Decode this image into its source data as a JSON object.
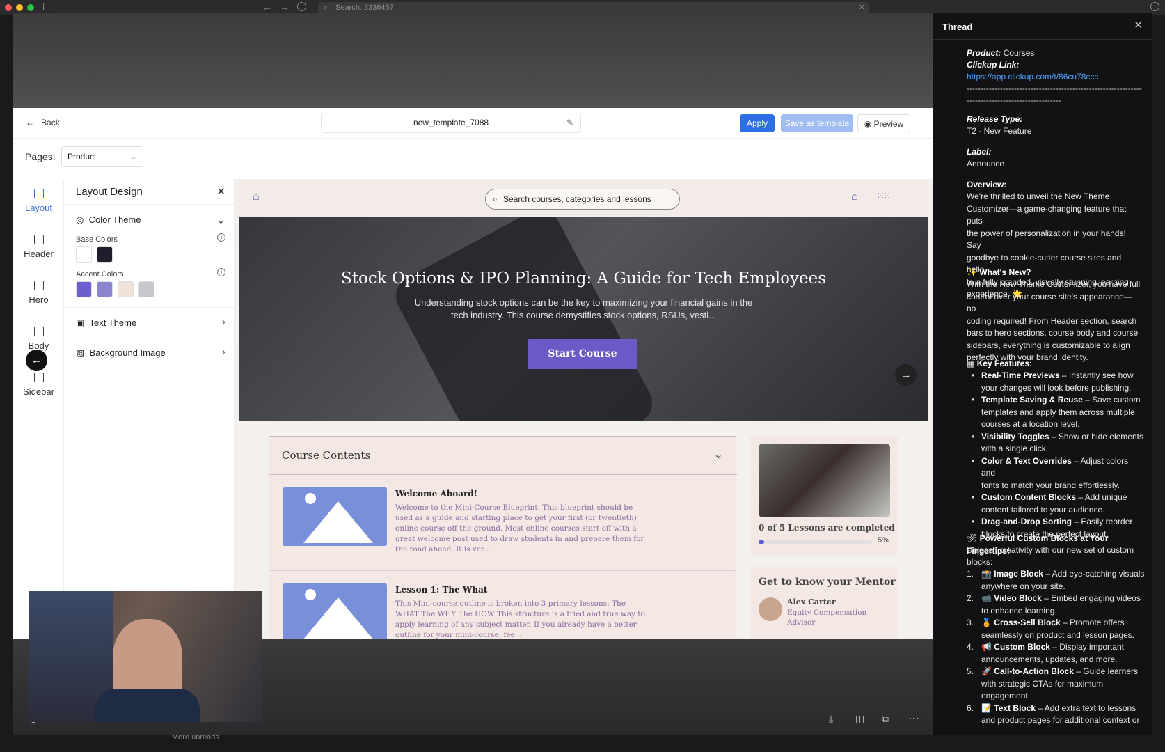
{
  "browser": {
    "search_placeholder": "Search: 3336457"
  },
  "editor": {
    "back_label": "Back",
    "template_name": "new_template_7088",
    "apply_label": "Apply",
    "save_template_label": "Save as template",
    "preview_label": "Preview",
    "pages_label": "Pages:",
    "pages_value": "Product"
  },
  "rail": [
    {
      "label": "Layout"
    },
    {
      "label": "Header"
    },
    {
      "label": "Hero"
    },
    {
      "label": "Body"
    },
    {
      "label": "Sidebar"
    }
  ],
  "panel": {
    "title": "Layout Design",
    "color_theme": "Color Theme",
    "base_colors_label": "Base Colors",
    "accent_colors_label": "Accent Colors",
    "text_theme": "Text Theme",
    "background_image": "Background Image",
    "base_colors": [
      "#ffffff",
      "#1e1d2b"
    ],
    "accent_colors": [
      "#6a5fcc",
      "#8a85cc",
      "#efe4dc",
      "#c8c6cc"
    ]
  },
  "preview": {
    "search_placeholder": "Search courses, categories and lessons",
    "hero_title": "Stock Options & IPO Planning: A Guide for Tech Employees",
    "hero_desc_1": "Understanding stock options can be the key to maximizing your financial gains in the",
    "hero_desc_2": "tech industry. This course demystifies stock options, RSUs, vesti...",
    "start_course": "Start Course",
    "course_contents": "Course Contents",
    "lessons": [
      {
        "title": "Welcome Aboard!",
        "lines": [
          "Welcome to the Mini-Course Blueprint. This blueprint should be",
          "used as a guide and starting place to get your first (or twentieth)",
          "online course off the ground. Most online courses start off with a",
          "great welcome post used to draw students in and prepare them for",
          "the road ahead. It is ver..."
        ]
      },
      {
        "title": "Lesson 1: The What",
        "lines": [
          "This Mini-course outline is broken into 3 primary lessons: The",
          "WHAT The WHY The HOW This structure is a tried and true way to",
          "apply learning of any subject matter. If you already have a better",
          "outline for your mini-course, fee..."
        ]
      }
    ],
    "progress_text": "0 of 5 Lessons are completed",
    "progress_pct": "5%",
    "progress_value": 0.05,
    "mentor_heading": "Get to know your Mentor",
    "mentor_name": "Alex Carter",
    "mentor_role_1": "Equity Compensation",
    "mentor_role_2": "Advisor"
  },
  "thread": {
    "title": "Thread",
    "product_label": "Product:",
    "product_value": "Courses",
    "clickup_label": "Clickup Link:",
    "clickup_url": "https://app.clickup.com/t/86cu78ccc",
    "divider_1": "-----------------------------------------------------------------",
    "divider_2": "----------------------------------",
    "release_label": "Release Type:",
    "release_value": "T2 - New Feature",
    "label_label": "Label:",
    "label_value": "Announce",
    "overview_label": "Overview:",
    "overview_lines": [
      "We're thrilled to unveil the New Theme",
      "Customizer—a game-changing feature that puts",
      "the power of personalization in your hands! Say",
      "goodbye to cookie-cutter course sites and hello",
      "to a fully branded, visually stunning learning",
      "experience."
    ],
    "whats_new": "What's New?",
    "whats_new_lines": [
      "With the New Theme Customizer, you have full",
      "control over your course site's appearance—no",
      "coding required! From Header section, search",
      "bars to hero sections, course body and course",
      "sidebars, everything is customizable to align",
      "perfectly with your brand identity."
    ],
    "key_features": "Key Features:",
    "features": [
      {
        "name": "Real-Time Previews",
        "text": " – Instantly see how",
        "text2": "your changes will look before publishing."
      },
      {
        "name": "Template Saving & Reuse",
        "text": " – Save custom",
        "text2": "templates and apply them across multiple",
        "text3": "courses at a location level."
      },
      {
        "name": "Visibility Toggles",
        "text": " – Show or hide elements",
        "text2": "with a single click."
      },
      {
        "name": "Color & Text Overrides",
        "text": " – Adjust colors and",
        "text2": "fonts to match your brand effortlessly."
      },
      {
        "name": "Custom Content Blocks",
        "text": " – Add unique",
        "text2": "content tailored to your audience."
      },
      {
        "name": "Drag-and-Drop Sorting",
        "text": " – Easily reorder",
        "text2": "blocks to create the perfect layout."
      }
    ],
    "blocks_heading": "Powerful Custom Blocks at Your Fingertips!",
    "blocks_intro_1": "Unleash creativity with our new set of custom",
    "blocks_intro_2": "blocks:",
    "blocks": [
      {
        "num": "1.",
        "name": "Image Block",
        "text": " – Add eye-catching visuals",
        "text2": "anywhere on your site."
      },
      {
        "num": "2.",
        "name": "Video Block",
        "text": " – Embed engaging videos",
        "text2": "to enhance learning."
      },
      {
        "num": "3.",
        "name": "Cross-Sell Block",
        "text": " – Promote offers",
        "text2": "seamlessly on product and lesson pages."
      },
      {
        "num": "4.",
        "name": "Custom Block",
        "text": " – Display important",
        "text2": "announcements, updates, and more."
      },
      {
        "num": "5.",
        "name": "Call-to-Action Block",
        "text": " – Guide learners",
        "text2": "with strategic CTAs for maximum",
        "text3": "engagement."
      },
      {
        "num": "6.",
        "name": "Text Block",
        "text": " – Add extra text to lessons",
        "text2": "and product pages for additional context or"
      }
    ]
  },
  "bottom": {
    "more_unreads": "More unreads"
  }
}
